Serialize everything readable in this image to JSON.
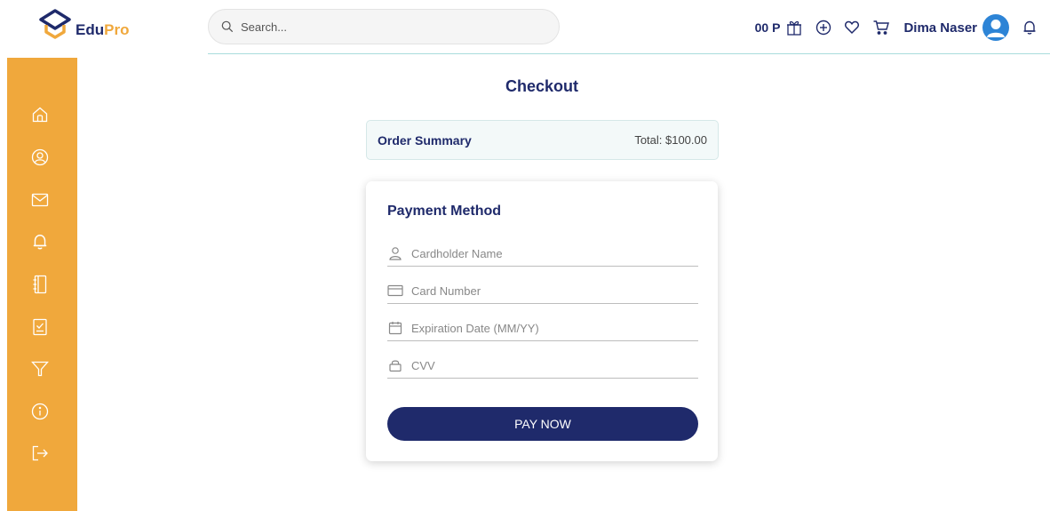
{
  "brand": {
    "part1": "Edu",
    "part2": "Pro",
    "primary": "#1f2a6b",
    "accent": "#f0a83c"
  },
  "search": {
    "placeholder": "Search..."
  },
  "header": {
    "points": "00 P",
    "user_name": "Dima Naser",
    "icons": [
      "gift-icon",
      "plus-circle-icon",
      "heart-icon",
      "cart-icon",
      "avatar",
      "bell-icon"
    ]
  },
  "sidebar": {
    "color": "#f0a83c",
    "items": [
      "home-icon",
      "user-icon",
      "mail-icon",
      "bell-icon",
      "notebook-icon",
      "checklist-icon",
      "filter-icon",
      "info-icon",
      "logout-icon"
    ]
  },
  "main": {
    "title": "Checkout",
    "order_summary": {
      "label": "Order Summary",
      "total": "Total: $100.00"
    },
    "payment": {
      "title": "Payment Method",
      "cardholder_placeholder": "Cardholder Name",
      "card_number_placeholder": "Card Number",
      "expiration_placeholder": "Expiration Date (MM/YY)",
      "cvv_placeholder": "CVV",
      "pay_button": "PAY NOW"
    }
  }
}
